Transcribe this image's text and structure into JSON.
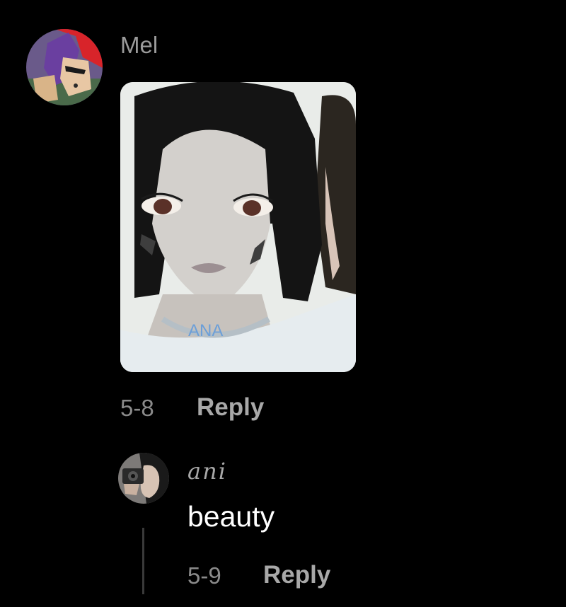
{
  "comments": [
    {
      "username": "Mel",
      "avatar_icon": "anime-character-avatar",
      "image_watermark": "ANA",
      "time": "5-8",
      "reply_label": "Reply"
    }
  ],
  "replies": [
    {
      "username": "ani",
      "avatar_icon": "photo-avatar",
      "text": "beauty",
      "time": "5-9",
      "reply_label": "Reply"
    }
  ],
  "colors": {
    "background": "#000000",
    "username": "#9b9b9b",
    "meta": "#8a8a8a",
    "reply": "#a8a8a8",
    "text": "#ffffff",
    "watermark": "#6c9fd8"
  }
}
